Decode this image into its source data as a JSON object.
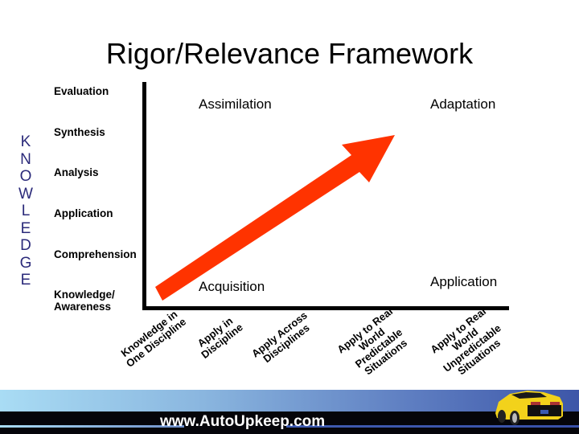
{
  "title": "Rigor/Relevance Framework",
  "knowledge_axis_letters": [
    "K",
    "N",
    "O",
    "W",
    "L",
    "E",
    "D",
    "G",
    "E"
  ],
  "knowledge_levels": [
    {
      "line1": "Evaluation",
      "line2": ""
    },
    {
      "line1": "Synthesis",
      "line2": ""
    },
    {
      "line1": "Analysis",
      "line2": ""
    },
    {
      "line1": "Application",
      "line2": ""
    },
    {
      "line1": "Comprehension",
      "line2": ""
    },
    {
      "line1": "Knowledge/",
      "line2": "Awareness"
    }
  ],
  "quadrants": {
    "top_left": "Assimilation",
    "top_right": "Adaptation",
    "bottom_left": "Acquisition",
    "bottom_right": "Application"
  },
  "application_levels": [
    {
      "lines": [
        "Knowledge in",
        "One Discipline"
      ]
    },
    {
      "lines": [
        "Apply in",
        "Discipline"
      ]
    },
    {
      "lines": [
        "Apply Across",
        "Disciplines"
      ]
    },
    {
      "lines": [
        "Apply to Real",
        "World",
        "Predictable",
        "Situations"
      ]
    },
    {
      "lines": [
        "Apply to Real",
        "World",
        "Unpredictable",
        "Situations"
      ]
    }
  ],
  "colors": {
    "arrow": "#ff3300",
    "knowledge_letters": "#2b2a7a",
    "axis": "#000000"
  },
  "footer": {
    "url": "www.AutoUpkeep.com",
    "car_image": "yellow-sports-car"
  }
}
